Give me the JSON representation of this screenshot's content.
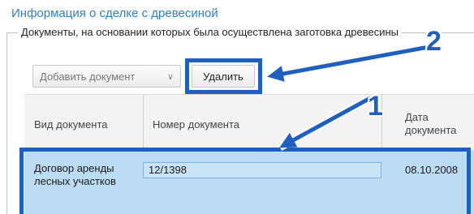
{
  "section": {
    "title": "Информация о сделке с древесиной"
  },
  "fieldset": {
    "legend": "Документы, на основании которых была осуществлена заготовка древесины"
  },
  "toolbar": {
    "add_label": "Добавить документ",
    "delete_label": "Удалить"
  },
  "table": {
    "columns": [
      "Вид документа",
      "Номер документа",
      "Дата документа"
    ],
    "rows": [
      {
        "type": "Договор аренды лесных участков",
        "number": "12/1398",
        "date": "08.10.2008"
      }
    ]
  },
  "annotations": {
    "marker_1": "1",
    "marker_2": "2"
  },
  "colors": {
    "accent": "#2f7fc1",
    "annotation": "#1f5fbe",
    "row_selected": "#bcdcf3"
  }
}
